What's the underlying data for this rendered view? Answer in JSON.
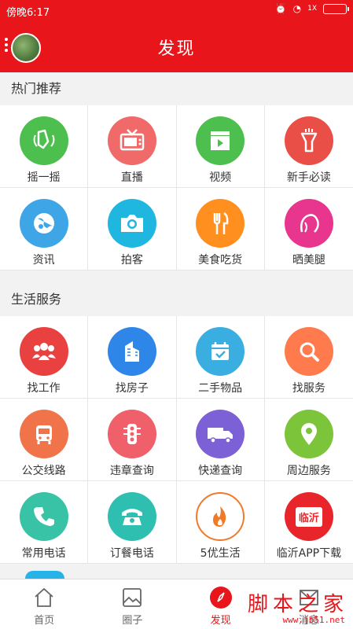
{
  "status": {
    "time": "傍晚6:17",
    "signal": "1X"
  },
  "header": {
    "title": "发现"
  },
  "hot": {
    "title": "热门推荐",
    "items": [
      {
        "label": "摇一摇",
        "icon": "shake-hand-icon",
        "color": "#4cbf4f"
      },
      {
        "label": "直播",
        "icon": "tv-icon",
        "color": "#f06a6a"
      },
      {
        "label": "视频",
        "icon": "video-clapper-icon",
        "color": "#4cbf4f"
      },
      {
        "label": "新手必读",
        "icon": "flashlight-icon",
        "color": "#e94e47"
      },
      {
        "label": "资讯",
        "icon": "globe-icon",
        "color": "#3ea5e6"
      },
      {
        "label": "拍客",
        "icon": "camera-icon",
        "color": "#1fb6e0"
      },
      {
        "label": "美食吃货",
        "icon": "fork-knife-icon",
        "color": "#ff8f1f"
      },
      {
        "label": "晒美腿",
        "icon": "woman-face-icon",
        "color": "#e8358d"
      }
    ]
  },
  "life": {
    "title": "生活服务",
    "items": [
      {
        "label": "找工作",
        "icon": "people-icon",
        "color": "#e94040"
      },
      {
        "label": "找房子",
        "icon": "building-icon",
        "color": "#2d86e8"
      },
      {
        "label": "二手物品",
        "icon": "calendar-check-icon",
        "color": "#3aaee0"
      },
      {
        "label": "找服务",
        "icon": "search-icon",
        "color": "#ff7a4d"
      },
      {
        "label": "公交线路",
        "icon": "bus-icon",
        "color": "#f0734a"
      },
      {
        "label": "违章查询",
        "icon": "traffic-light-icon",
        "color": "#f0606b"
      },
      {
        "label": "快递查询",
        "icon": "truck-icon",
        "color": "#7c61d6"
      },
      {
        "label": "周边服务",
        "icon": "location-pin-icon",
        "color": "#7cc43a"
      },
      {
        "label": "常用电话",
        "icon": "phone-icon",
        "color": "#38c2a6"
      },
      {
        "label": "订餐电话",
        "icon": "rotary-phone-icon",
        "color": "#2fbfb0"
      },
      {
        "label": "5优生活",
        "icon": "flame-icon",
        "color": "#f07a2a"
      },
      {
        "label": "临沂APP下载",
        "icon": "linyi-app-icon",
        "color": "#e8252b",
        "badge": "临沂"
      }
    ]
  },
  "tabbar": {
    "items": [
      {
        "label": "首页",
        "icon": "home-icon"
      },
      {
        "label": "圈子",
        "icon": "image-icon"
      },
      {
        "label": "发现",
        "icon": "compass-icon"
      },
      {
        "label": "消息",
        "icon": "message-icon"
      }
    ]
  },
  "watermark": {
    "brand": "脚本之家",
    "url": "www.jb51.net"
  }
}
